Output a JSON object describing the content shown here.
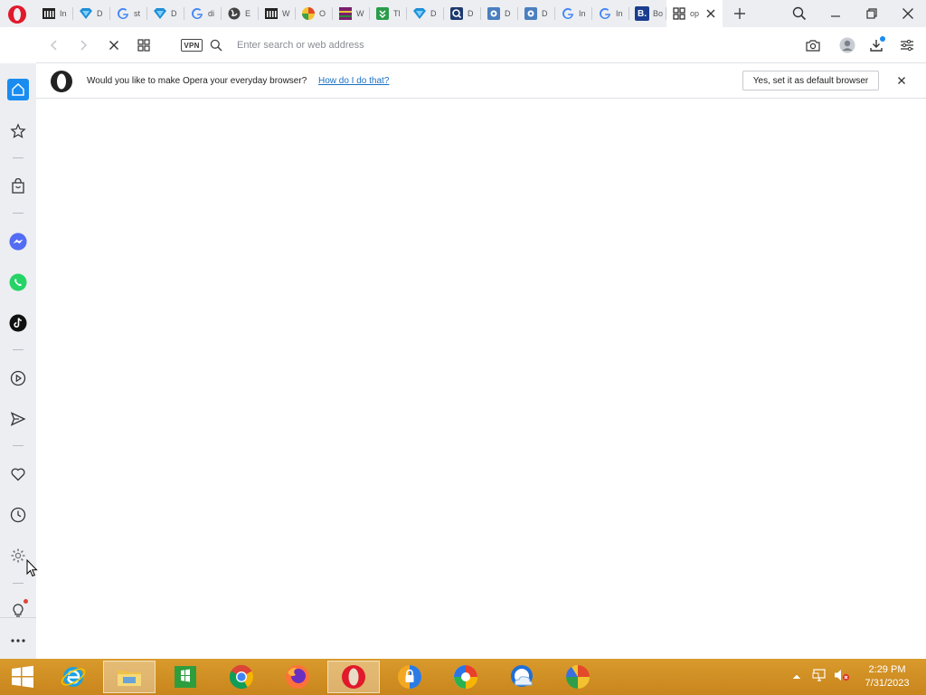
{
  "tabs": [
    {
      "icon": "library-icon",
      "label": "In",
      "color": "#333333"
    },
    {
      "icon": "diamond-icon",
      "label": "D",
      "color": "#1e8fd6"
    },
    {
      "icon": "google-icon",
      "label": "st",
      "color": "#4285f4"
    },
    {
      "icon": "diamond-icon",
      "label": "D",
      "color": "#1e8fd6"
    },
    {
      "icon": "google-icon",
      "label": "di",
      "color": "#4285f4"
    },
    {
      "icon": "globe-icon",
      "label": "E",
      "color": "#555555"
    },
    {
      "icon": "library-icon",
      "label": "W",
      "color": "#333333"
    },
    {
      "icon": "colorful-circle-icon",
      "label": "O",
      "color": "#e0a020"
    },
    {
      "icon": "winrar-icon",
      "label": "W",
      "color": "#7a1f6e"
    },
    {
      "icon": "download-arrow-icon",
      "label": "Tl",
      "color": "#2a9d4a"
    },
    {
      "icon": "diamond-icon",
      "label": "D",
      "color": "#1e8fd6"
    },
    {
      "icon": "magnifier-q-icon",
      "label": "D",
      "color": "#1f3a6e"
    },
    {
      "icon": "puzzle-icon",
      "label": "D",
      "color": "#4a7fc0"
    },
    {
      "icon": "puzzle-icon",
      "label": "D",
      "color": "#4a7fc0"
    },
    {
      "icon": "google-icon",
      "label": "In",
      "color": "#4285f4"
    },
    {
      "icon": "google-icon",
      "label": "In",
      "color": "#4285f4"
    },
    {
      "icon": "booking-icon",
      "label": "Bo",
      "color": "#1a3d8f"
    }
  ],
  "active_tab": {
    "icon": "grid-icon",
    "label": "op"
  },
  "address_bar": {
    "placeholder": "Enter search or web address",
    "value": "",
    "vpn_label": "VPN"
  },
  "infobar": {
    "message": "Would you like to make Opera your everyday browser?",
    "link": "How do I do that?",
    "button": "Yes, set it as default browser"
  },
  "sidebar": [
    "home-icon",
    "star-icon",
    "shopping-bag-icon",
    "messenger-icon",
    "whatsapp-icon",
    "tiktok-icon",
    "player-icon",
    "send-icon",
    "heart-icon",
    "clock-icon",
    "settings-icon",
    "lightbulb-icon",
    "more-icon"
  ],
  "taskbar": {
    "apps": [
      "internet-explorer-icon",
      "file-explorer-icon",
      "store-icon",
      "chrome-icon",
      "firefox-icon",
      "opera-icon",
      "vpn-lock-icon",
      "pinwheel-icon",
      "cloud-browser-icon",
      "colorful-app-icon"
    ],
    "active_app": "opera-icon",
    "time": "2:29 PM",
    "date": "7/31/2023"
  },
  "colors": {
    "accent": "#1a8cf0",
    "opera_red": "#e0192b",
    "taskbar": "#d99a2c",
    "link": "#1a6fc4"
  }
}
